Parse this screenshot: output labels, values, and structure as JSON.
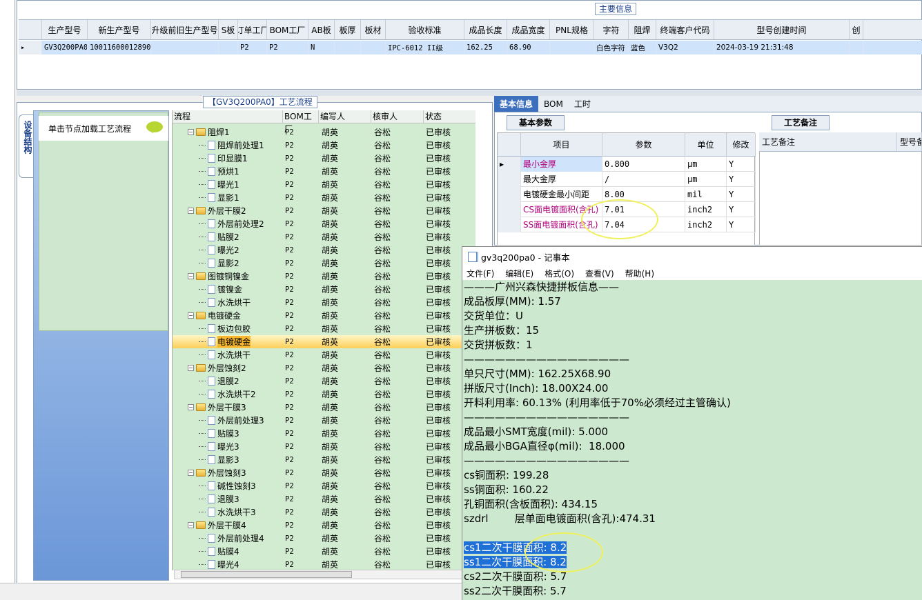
{
  "main_panel": {
    "title": "主要信息",
    "columns": [
      "生产型号",
      "新生产型号",
      "升级前旧生产型号",
      "S板",
      "订单工厂",
      "BOM工厂",
      "AB板",
      "板厚",
      "板材",
      "验收标准",
      "成品长度",
      "成品宽度",
      "PNL规格",
      "字符",
      "阻焊",
      "终端客户代码",
      "型号创建时间",
      "创"
    ],
    "row": [
      "GV3Q200PA0",
      "10011600012890",
      "",
      "",
      "P2",
      "P2",
      "N",
      "",
      "",
      "IPC-6012 II级",
      "162.25",
      "68.90",
      "",
      "白色字符",
      "蓝色",
      "V3Q2",
      "2024-03-19 21:31:48",
      ""
    ]
  },
  "flow_panel": {
    "title": "【GV3Q200PA0】工艺流程",
    "vertical_tab": "设备结构",
    "hint": "单击节点加载工艺流程",
    "columns": [
      "流程",
      "BOM工厂",
      "编写人",
      "核审人",
      "状态"
    ],
    "rows": [
      {
        "name": "阻焊1",
        "type": "folder",
        "level": 1,
        "bom": "P2",
        "writer": "胡英",
        "reviewer": "谷松",
        "status": "已审核"
      },
      {
        "name": "阻焊前处理1",
        "type": "doc",
        "level": 2,
        "bom": "P2",
        "writer": "胡英",
        "reviewer": "谷松",
        "status": "已审核"
      },
      {
        "name": "印显膜1",
        "type": "doc",
        "level": 2,
        "bom": "P2",
        "writer": "胡英",
        "reviewer": "谷松",
        "status": "已审核"
      },
      {
        "name": "预烘1",
        "type": "doc",
        "level": 2,
        "bom": "P2",
        "writer": "胡英",
        "reviewer": "谷松",
        "status": "已审核"
      },
      {
        "name": "曝光1",
        "type": "doc",
        "level": 2,
        "bom": "P2",
        "writer": "胡英",
        "reviewer": "谷松",
        "status": "已审核"
      },
      {
        "name": "显影1",
        "type": "doc",
        "level": 2,
        "bom": "P2",
        "writer": "胡英",
        "reviewer": "谷松",
        "status": "已审核"
      },
      {
        "name": "外层干膜2",
        "type": "folder",
        "level": 1,
        "bom": "P2",
        "writer": "胡英",
        "reviewer": "谷松",
        "status": "已审核"
      },
      {
        "name": "外层前处理2",
        "type": "doc",
        "level": 2,
        "bom": "P2",
        "writer": "胡英",
        "reviewer": "谷松",
        "status": "已审核"
      },
      {
        "name": "贴膜2",
        "type": "doc",
        "level": 2,
        "bom": "P2",
        "writer": "胡英",
        "reviewer": "谷松",
        "status": "已审核"
      },
      {
        "name": "曝光2",
        "type": "doc",
        "level": 2,
        "bom": "P2",
        "writer": "胡英",
        "reviewer": "谷松",
        "status": "已审核"
      },
      {
        "name": "显影2",
        "type": "doc",
        "level": 2,
        "bom": "P2",
        "writer": "胡英",
        "reviewer": "谷松",
        "status": "已审核"
      },
      {
        "name": "图镀铜镍金",
        "type": "folder",
        "level": 1,
        "bom": "P2",
        "writer": "胡英",
        "reviewer": "谷松",
        "status": "已审核"
      },
      {
        "name": "镀镍金",
        "type": "doc",
        "level": 2,
        "bom": "P2",
        "writer": "胡英",
        "reviewer": "谷松",
        "status": "已审核"
      },
      {
        "name": "水洗烘干",
        "type": "doc",
        "level": 2,
        "bom": "P2",
        "writer": "胡英",
        "reviewer": "谷松",
        "status": "已审核"
      },
      {
        "name": "电镀硬金",
        "type": "folder",
        "level": 1,
        "bom": "P2",
        "writer": "胡英",
        "reviewer": "谷松",
        "status": "已审核"
      },
      {
        "name": "板边包胶",
        "type": "doc",
        "level": 2,
        "bom": "P2",
        "writer": "胡英",
        "reviewer": "谷松",
        "status": "已审核"
      },
      {
        "name": "电镀硬金",
        "type": "doc",
        "level": 2,
        "bom": "P2",
        "writer": "胡英",
        "reviewer": "谷松",
        "status": "已审核",
        "selected": true
      },
      {
        "name": "水洗烘干",
        "type": "doc",
        "level": 2,
        "bom": "P2",
        "writer": "胡英",
        "reviewer": "谷松",
        "status": "已审核"
      },
      {
        "name": "外层蚀刻2",
        "type": "folder",
        "level": 1,
        "bom": "P2",
        "writer": "胡英",
        "reviewer": "谷松",
        "status": "已审核"
      },
      {
        "name": "退膜2",
        "type": "doc",
        "level": 2,
        "bom": "P2",
        "writer": "胡英",
        "reviewer": "谷松",
        "status": "已审核"
      },
      {
        "name": "水洗烘干2",
        "type": "doc",
        "level": 2,
        "bom": "P2",
        "writer": "胡英",
        "reviewer": "谷松",
        "status": "已审核"
      },
      {
        "name": "外层干膜3",
        "type": "folder",
        "level": 1,
        "bom": "P2",
        "writer": "胡英",
        "reviewer": "谷松",
        "status": "已审核"
      },
      {
        "name": "外层前处理3",
        "type": "doc",
        "level": 2,
        "bom": "P2",
        "writer": "胡英",
        "reviewer": "谷松",
        "status": "已审核"
      },
      {
        "name": "贴膜3",
        "type": "doc",
        "level": 2,
        "bom": "P2",
        "writer": "胡英",
        "reviewer": "谷松",
        "status": "已审核"
      },
      {
        "name": "曝光3",
        "type": "doc",
        "level": 2,
        "bom": "P2",
        "writer": "胡英",
        "reviewer": "谷松",
        "status": "已审核"
      },
      {
        "name": "显影3",
        "type": "doc",
        "level": 2,
        "bom": "P2",
        "writer": "胡英",
        "reviewer": "谷松",
        "status": "已审核"
      },
      {
        "name": "外层蚀刻3",
        "type": "folder",
        "level": 1,
        "bom": "P2",
        "writer": "胡英",
        "reviewer": "谷松",
        "status": "已审核"
      },
      {
        "name": "碱性蚀刻3",
        "type": "doc",
        "level": 2,
        "bom": "P2",
        "writer": "胡英",
        "reviewer": "谷松",
        "status": "已审核"
      },
      {
        "name": "退膜3",
        "type": "doc",
        "level": 2,
        "bom": "P2",
        "writer": "胡英",
        "reviewer": "谷松",
        "status": "已审核"
      },
      {
        "name": "水洗烘干3",
        "type": "doc",
        "level": 2,
        "bom": "P2",
        "writer": "胡英",
        "reviewer": "谷松",
        "status": "已审核"
      },
      {
        "name": "外层干膜4",
        "type": "folder",
        "level": 1,
        "bom": "P2",
        "writer": "胡英",
        "reviewer": "谷松",
        "status": "已审核"
      },
      {
        "name": "外层前处理4",
        "type": "doc",
        "level": 2,
        "bom": "P2",
        "writer": "胡英",
        "reviewer": "谷松",
        "status": "已审核"
      },
      {
        "name": "贴膜4",
        "type": "doc",
        "level": 2,
        "bom": "P2",
        "writer": "胡英",
        "reviewer": "谷松",
        "status": "已审核"
      },
      {
        "name": "曝光4",
        "type": "doc",
        "level": 2,
        "bom": "P2",
        "writer": "胡英",
        "reviewer": "谷松",
        "status": "已审核"
      }
    ]
  },
  "right_panel": {
    "tabs": [
      "基本信息",
      "BOM",
      "工时"
    ],
    "basic_params_tab": "基本参数",
    "remark_tab": "工艺备注",
    "param_columns": [
      "项目",
      "参数",
      "单位",
      "修改"
    ],
    "params": [
      {
        "item": "最小金厚",
        "value": "0.800",
        "unit": "μm",
        "mod": "Y",
        "color": "#b0007a"
      },
      {
        "item": "最大金厚",
        "value": "/",
        "unit": "μm",
        "mod": "Y",
        "color": "#000000"
      },
      {
        "item": "电镀硬金最小间距",
        "value": "8.00",
        "unit": "mil",
        "mod": "Y",
        "color": "#000000"
      },
      {
        "item": "CS面电镀面积(含孔)",
        "value": "7.01",
        "unit": "inch2",
        "mod": "Y",
        "color": "#b0007a"
      },
      {
        "item": "SS面电镀面积(含孔)",
        "value": "7.04",
        "unit": "inch2",
        "mod": "Y",
        "color": "#b0007a"
      }
    ],
    "remark_columns": [
      "工艺备注",
      "型号备"
    ]
  },
  "notepad": {
    "title": "gv3q200pa0 - 记事本",
    "menu": [
      "文件(F)",
      "编辑(E)",
      "格式(O)",
      "查看(V)",
      "帮助(H)"
    ],
    "lines": [
      {
        "text": "———广州兴森快捷拼板信息——"
      },
      {
        "text": "成品板厚(MM): 1.57"
      },
      {
        "text": "交货单位：U"
      },
      {
        "text": "生产拼板数：15"
      },
      {
        "text": "交货拼板数：1"
      },
      {
        "text": "————————————————"
      },
      {
        "text": "单只尺寸(MM): 162.25X68.90"
      },
      {
        "text": "拼版尺寸(Inch): 18.00X24.00"
      },
      {
        "text": "开料利用率: 60.13% (利用率低于70%必须经过主管确认)"
      },
      {
        "text": "————————————————"
      },
      {
        "text": "成品最小SMT宽度(mil): 5.000"
      },
      {
        "text": "成品最小BGA直径φ(mil):  18.000"
      },
      {
        "text": "————————————————"
      },
      {
        "text": "cs铜面积: 199.28"
      },
      {
        "text": "ss铜面积: 160.22"
      },
      {
        "text": "孔铜面积(含板面积): 434.15"
      },
      {
        "text": "szdrl        层单面电镀面积(含孔):474.31"
      },
      {
        "text": ""
      },
      {
        "text": "cs1二次干膜面积: 8.2",
        "highlight": true
      },
      {
        "text": "ss1二次干膜面积: 8.2",
        "highlight": true
      },
      {
        "text": "cs2二次干膜面积: 5.7"
      },
      {
        "text": "ss2二次干膜面积: 5.7"
      }
    ]
  },
  "colors": {
    "accent": "#3d6fbf",
    "selection": "#cfe3fb",
    "tree_bg": "#d2ecd2",
    "notepad_bg": "#cce8cf",
    "annotation": "#f0f05a"
  }
}
